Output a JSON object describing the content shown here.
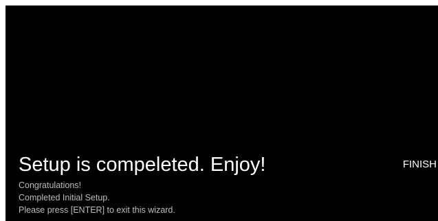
{
  "wizard": {
    "title": "Setup is compeleted. Enjoy!",
    "finish_label": "FINISH",
    "messages": [
      "Congratulations!",
      "Completed Initial Setup.",
      "Please press [ENTER] to exit this wizard."
    ]
  },
  "colors": {
    "background": "#000000",
    "title_text": "#ffffff",
    "body_text": "#bdbdbd"
  }
}
